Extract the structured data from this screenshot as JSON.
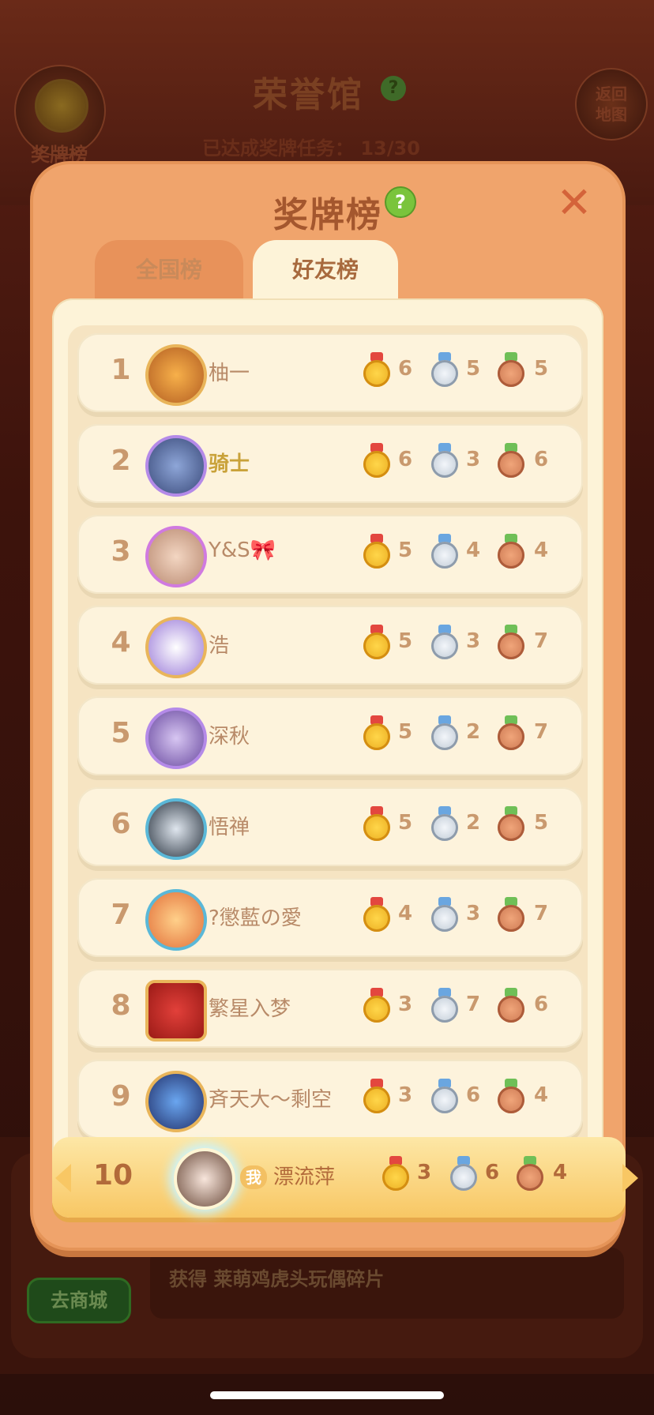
{
  "hall": {
    "top_left_label": "奖牌榜",
    "title": "荣誉馆",
    "subtitle": "已达成奖牌任务： 13/30",
    "return_btn_line1": "返回",
    "return_btn_line2": "地图"
  },
  "modal": {
    "title": "奖牌榜",
    "help": "?",
    "close": "✕",
    "tabs": [
      {
        "label": "全国榜",
        "active": false
      },
      {
        "label": "好友榜",
        "active": true
      }
    ]
  },
  "leaderboard": [
    {
      "rank": "1",
      "name": "柚一",
      "gold": "6",
      "silver": "5",
      "bronze": "5"
    },
    {
      "rank": "2",
      "name": "骑士",
      "gold": "6",
      "silver": "3",
      "bronze": "6"
    },
    {
      "rank": "3",
      "name": "Y&S🎀",
      "gold": "5",
      "silver": "4",
      "bronze": "4"
    },
    {
      "rank": "4",
      "name": "浩",
      "gold": "5",
      "silver": "3",
      "bronze": "7"
    },
    {
      "rank": "5",
      "name": "深秋",
      "gold": "5",
      "silver": "2",
      "bronze": "7"
    },
    {
      "rank": "6",
      "name": "悟禅",
      "gold": "5",
      "silver": "2",
      "bronze": "5"
    },
    {
      "rank": "7",
      "name": "?懲藍の愛",
      "gold": "4",
      "silver": "3",
      "bronze": "7"
    },
    {
      "rank": "8",
      "name": "繁星入梦",
      "gold": "3",
      "silver": "7",
      "bronze": "6"
    },
    {
      "rank": "9",
      "name": "斉天大～剩空",
      "gold": "3",
      "silver": "6",
      "bronze": "4"
    }
  ],
  "me": {
    "rank": "10",
    "tag": "我",
    "name": "漂流萍",
    "gold": "3",
    "silver": "6",
    "bronze": "4"
  },
  "footer": {
    "shop_button": "去商城",
    "reward_text": "获得 莱萌鸡虎头玩偶碎片"
  },
  "colors": {
    "gold_medal": "#ffd64a",
    "silver_medal": "#c8d2dc",
    "bronze_medal": "#d98a5e",
    "modal_bg": "#f0a46c",
    "row_bg": "#fdf3dc"
  }
}
